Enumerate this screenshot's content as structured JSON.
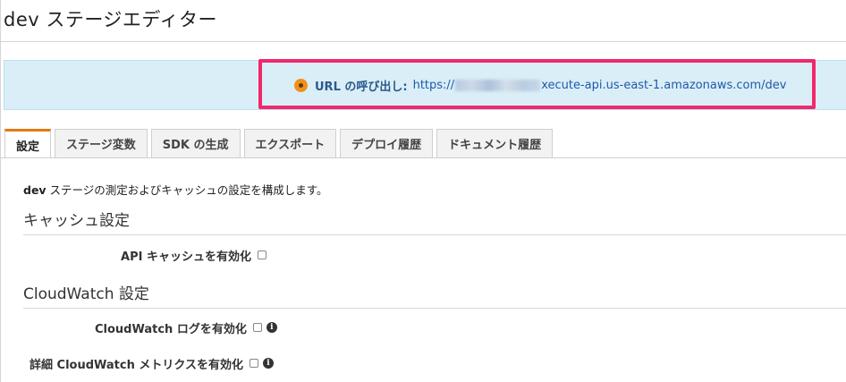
{
  "page": {
    "title": "dev ステージエディター"
  },
  "invoke": {
    "label": "URL の呼び出し:",
    "url_prefix": "https://",
    "url_suffix": "xecute-api.us-east-1.amazonaws.com/dev",
    "status_color": "#f0901c"
  },
  "tabs": [
    {
      "label": "設定",
      "active": true
    },
    {
      "label": "ステージ変数"
    },
    {
      "label": "SDK の生成"
    },
    {
      "label": "エクスポート"
    },
    {
      "label": "デプロイ履歴"
    },
    {
      "label": "ドキュメント履歴"
    }
  ],
  "settings": {
    "description_bold": "dev",
    "description_rest": " ステージの測定およびキャッシュの設定を構成します。",
    "cache_section": "キャッシュ設定",
    "api_cache_label": "API キャッシュを有効化",
    "cloudwatch_section": "CloudWatch 設定",
    "cw_logs_label": "CloudWatch ログを有効化",
    "cw_metrics_label": "詳細 CloudWatch メトリクスを有効化"
  },
  "icons": {
    "info": "info-icon",
    "status": "status-dot-icon"
  }
}
